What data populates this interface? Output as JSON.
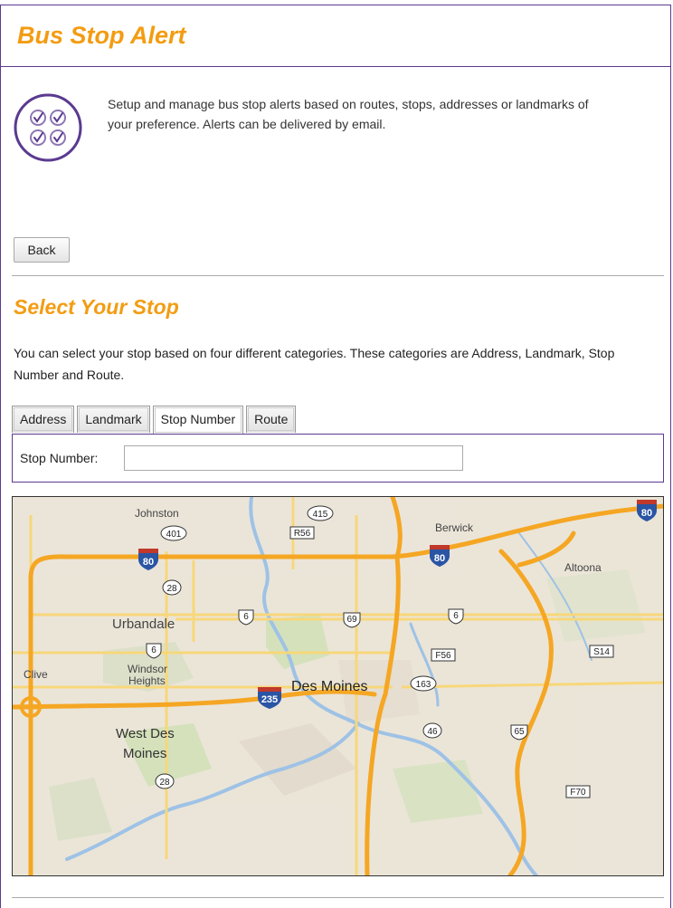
{
  "header": {
    "title": "Bus Stop Alert"
  },
  "intro": {
    "description": "Setup and manage bus stop alerts based on routes, stops, addresses or landmarks of your preference. Alerts can be delivered by email.",
    "icon": "checklist-icon"
  },
  "actions": {
    "back_label": "Back"
  },
  "select_stop": {
    "title": "Select Your Stop",
    "description": "You can select your stop based on four different categories. These categories are Address, Landmark, Stop Number and Route.",
    "tabs": [
      {
        "label": "Address"
      },
      {
        "label": "Landmark"
      },
      {
        "label": "Stop Number"
      },
      {
        "label": "Route"
      }
    ],
    "active_tab": "Stop Number",
    "field_label": "Stop Number:",
    "field_value": "",
    "field_placeholder": ""
  },
  "map": {
    "places": {
      "johnston": "Johnston",
      "berwick": "Berwick",
      "altoona": "Altoona",
      "urbandale": "Urbandale",
      "clive": "Clive",
      "windsor1": "Windsor",
      "windsor2": "Heights",
      "des_moines": "Des Moines",
      "west_des1": "West Des",
      "west_des2": "Moines"
    },
    "shields": {
      "i80": "80",
      "i235": "235",
      "us6": "6",
      "us65": "65",
      "us69": "69",
      "ia28": "28",
      "ia401": "401",
      "ia415": "415",
      "ia163": "163",
      "ia46": "46",
      "r56": "R56",
      "f56": "F56",
      "s14": "S14",
      "f70": "F70"
    }
  },
  "colors": {
    "accent": "#f39c12",
    "border": "#5b3a8f",
    "highway": "#f5a623"
  }
}
